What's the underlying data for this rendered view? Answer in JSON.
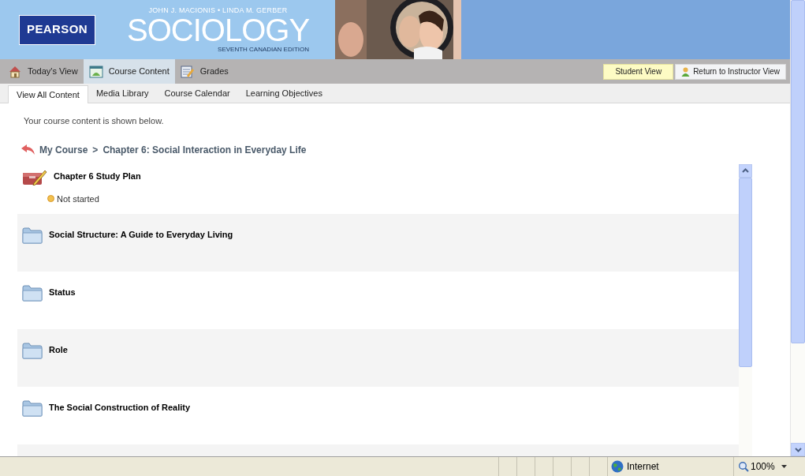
{
  "banner": {
    "publisher": "PEARSON",
    "authors": "JOHN J. MACIONIS • LINDA M. GERBER",
    "title": "SOCIOLOGY",
    "edition": "SEVENTH CANADIAN EDITION"
  },
  "main_tabs": [
    {
      "label": "Today's View",
      "kind": "home",
      "selected": false
    },
    {
      "label": "Course Content",
      "kind": "content",
      "selected": true
    },
    {
      "label": "Grades",
      "kind": "grades",
      "selected": false
    }
  ],
  "view_buttons": [
    {
      "label": "Student View",
      "selected": true
    },
    {
      "label": "Return to Instructor View",
      "selected": false
    }
  ],
  "sub_tabs": [
    {
      "label": "View All Content",
      "selected": true
    },
    {
      "label": "Media Library",
      "selected": false
    },
    {
      "label": "Course Calendar",
      "selected": false
    },
    {
      "label": "Learning Objectives",
      "selected": false
    }
  ],
  "intro": "Your course content is shown below.",
  "breadcrumb": {
    "items": [
      "My Course",
      "Chapter 6: Social Interaction in Everyday Life"
    ],
    "separator": ">"
  },
  "items": [
    {
      "kind": "study_plan",
      "title": "Chapter 6 Study Plan",
      "status": "Not started"
    },
    {
      "kind": "folder",
      "title": "Social Structure: A Guide to Everyday Living"
    },
    {
      "kind": "folder",
      "title": "Status"
    },
    {
      "kind": "folder",
      "title": "Role"
    },
    {
      "kind": "folder",
      "title": "The Social Construction of Reality"
    }
  ],
  "status_bar": {
    "zone": "Internet",
    "zoom": "100%"
  }
}
